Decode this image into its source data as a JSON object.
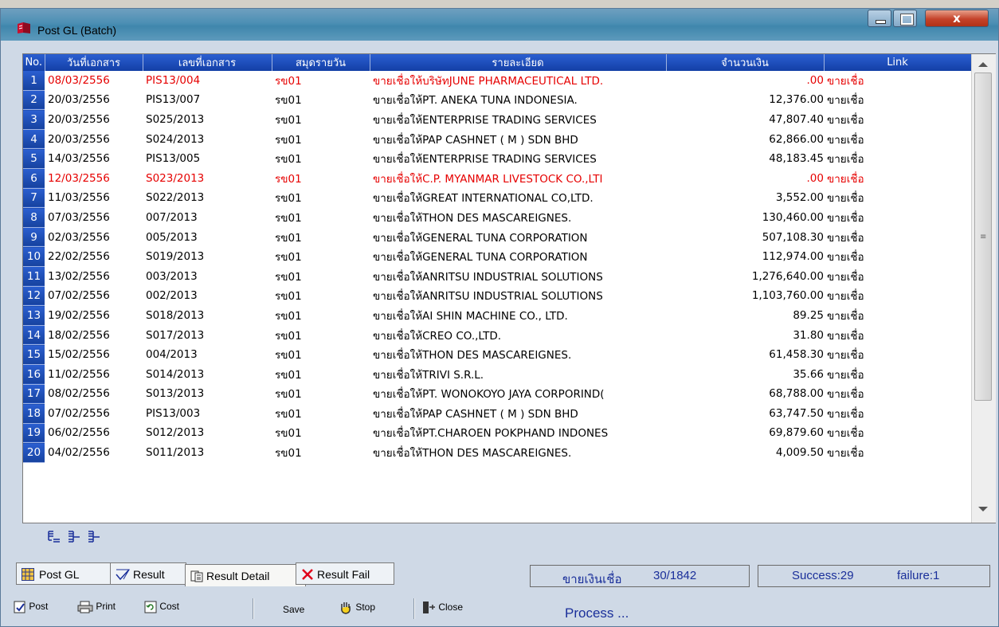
{
  "window": {
    "title": "Post GL (Batch)"
  },
  "columns": [
    "No.",
    "วันที่เอกสาร",
    "เลขที่เอกสาร",
    "สมุดรายวัน",
    "รายละเอียด",
    "จำนวนเงิน",
    "Link"
  ],
  "rows": [
    {
      "no": "1",
      "date": "08/03/2556",
      "doc": "PIS13/004",
      "journal": "รข01",
      "desc": "ขายเชื่อให้บริษัทJUNE PHARMACEUTICAL LTD.",
      "amount": ".00",
      "link": "ขายเชื่อ",
      "error": true
    },
    {
      "no": "2",
      "date": "20/03/2556",
      "doc": "PIS13/007",
      "journal": "รข01",
      "desc": "ขายเชื่อให้PT. ANEKA  TUNA INDONESIA.",
      "amount": "12,376.00",
      "link": "ขายเชื่อ"
    },
    {
      "no": "3",
      "date": "20/03/2556",
      "doc": "S025/2013",
      "journal": "รข01",
      "desc": "ขายเชื่อให้ENTERPRISE TRADING SERVICES",
      "amount": "47,807.40",
      "link": "ขายเชื่อ"
    },
    {
      "no": "4",
      "date": "20/03/2556",
      "doc": "S024/2013",
      "journal": "รข01",
      "desc": "ขายเชื่อให้PAP CASHNET ( M )  SDN BHD",
      "amount": "62,866.00",
      "link": "ขายเชื่อ"
    },
    {
      "no": "5",
      "date": "14/03/2556",
      "doc": "PIS13/005",
      "journal": "รข01",
      "desc": "ขายเชื่อให้ENTERPRISE TRADING SERVICES",
      "amount": "48,183.45",
      "link": "ขายเชื่อ"
    },
    {
      "no": "6",
      "date": "12/03/2556",
      "doc": "S023/2013",
      "journal": "รข01",
      "desc": "ขายเชื่อให้C.P. MYANMAR  LIVESTOCK CO.,LTI",
      "amount": ".00",
      "link": "ขายเชื่อ",
      "error": true
    },
    {
      "no": "7",
      "date": "11/03/2556",
      "doc": "S022/2013",
      "journal": "รข01",
      "desc": "ขายเชื่อให้GREAT INTERNATIONAL CO,LTD.",
      "amount": "3,552.00",
      "link": "ขายเชื่อ"
    },
    {
      "no": "8",
      "date": "07/03/2556",
      "doc": "007/2013",
      "journal": "รข01",
      "desc": "ขายเชื่อให้THON DES MASCAREIGNES.",
      "amount": "130,460.00",
      "link": "ขายเชื่อ"
    },
    {
      "no": "9",
      "date": "02/03/2556",
      "doc": "005/2013",
      "journal": "รข01",
      "desc": "ขายเชื่อให้GENERAL TUNA CORPORATION",
      "amount": "507,108.30",
      "link": "ขายเชื่อ"
    },
    {
      "no": "10",
      "date": "22/02/2556",
      "doc": "S019/2013",
      "journal": "รข01",
      "desc": "ขายเชื่อให้GENERAL TUNA CORPORATION",
      "amount": "112,974.00",
      "link": "ขายเชื่อ"
    },
    {
      "no": "11",
      "date": "13/02/2556",
      "doc": "003/2013",
      "journal": "รข01",
      "desc": "ขายเชื่อให้ANRITSU INDUSTRIAL SOLUTIONS",
      "amount": "1,276,640.00",
      "link": "ขายเชื่อ"
    },
    {
      "no": "12",
      "date": "07/02/2556",
      "doc": "002/2013",
      "journal": "รข01",
      "desc": "ขายเชื่อให้ANRITSU INDUSTRIAL SOLUTIONS",
      "amount": "1,103,760.00",
      "link": "ขายเชื่อ"
    },
    {
      "no": "13",
      "date": "19/02/2556",
      "doc": "S018/2013",
      "journal": "รข01",
      "desc": "ขายเชื่อให้AI SHIN MACHINE CO., LTD.",
      "amount": "89.25",
      "link": "ขายเชื่อ"
    },
    {
      "no": "14",
      "date": "18/02/2556",
      "doc": "S017/2013",
      "journal": "รข01",
      "desc": "ขายเชื่อให้CREO CO.,LTD.",
      "amount": "31.80",
      "link": "ขายเชื่อ"
    },
    {
      "no": "15",
      "date": "15/02/2556",
      "doc": "004/2013",
      "journal": "รข01",
      "desc": "ขายเชื่อให้THON DES MASCAREIGNES.",
      "amount": "61,458.30",
      "link": "ขายเชื่อ"
    },
    {
      "no": "16",
      "date": "11/02/2556",
      "doc": "S014/2013",
      "journal": "รข01",
      "desc": "ขายเชื่อให้TRIVI S.R.L.",
      "amount": "35.66",
      "link": "ขายเชื่อ"
    },
    {
      "no": "17",
      "date": "08/02/2556",
      "doc": "S013/2013",
      "journal": "รข01",
      "desc": "ขายเชื่อให้PT. WONOKOYO JAYA CORPORIND(",
      "amount": "68,788.00",
      "link": "ขายเชื่อ"
    },
    {
      "no": "18",
      "date": "07/02/2556",
      "doc": "PIS13/003",
      "journal": "รข01",
      "desc": "ขายเชื่อให้PAP CASHNET ( M )  SDN BHD",
      "amount": "63,747.50",
      "link": "ขายเชื่อ"
    },
    {
      "no": "19",
      "date": "06/02/2556",
      "doc": "S012/2013",
      "journal": "รข01",
      "desc": "ขายเชื่อให้PT.CHAROEN POKPHAND INDONES",
      "amount": "69,879.60",
      "link": "ขายเชื่อ"
    },
    {
      "no": "20",
      "date": "04/02/2556",
      "doc": "S011/2013",
      "journal": "รข01",
      "desc": "ขายเชื่อให้THON DES MASCAREIGNES.",
      "amount": "4,009.50",
      "link": "ขายเชื่อ"
    }
  ],
  "tabs": [
    {
      "id": "post-gl",
      "label": "Post GL"
    },
    {
      "id": "result",
      "label": "Result"
    },
    {
      "id": "result-detail",
      "label": "Result Detail"
    },
    {
      "id": "result-fail",
      "label": "Result Fail"
    }
  ],
  "status": {
    "type_label": "ขายเงินเชื่อ",
    "progress": "30/1842",
    "success": "Success:29",
    "failure": "failure:1",
    "process": "Process ..."
  },
  "toolbar": {
    "post": "Post",
    "print": "Print",
    "cost": "Cost",
    "save": "Save",
    "stop": "Stop",
    "close": "Close"
  },
  "colors": {
    "error_row": "#e60000",
    "header_blue": "#1e4fbf",
    "status_text": "#1a2f9a"
  }
}
